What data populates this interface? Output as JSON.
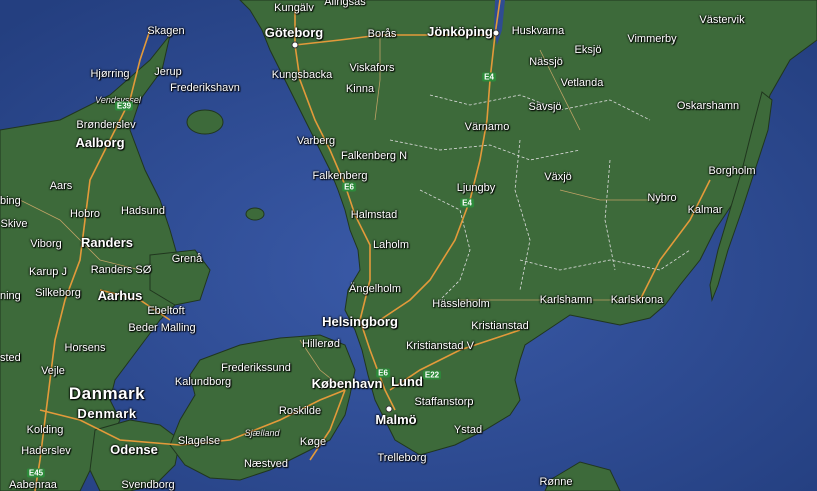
{
  "map": {
    "colors": {
      "sea": "#2f4c92",
      "land": "#3f6b3a",
      "land_dark": "#2f5530",
      "road": "#e8a040",
      "border": "#ffffff"
    },
    "labels": [
      {
        "name": "label-kungalv",
        "text": "Kungälv",
        "kind": "city"
      },
      {
        "name": "label-alingsas",
        "text": "Alingsås",
        "kind": "city"
      },
      {
        "name": "label-goteborg",
        "text": "Göteborg",
        "kind": "big"
      },
      {
        "name": "label-boras",
        "text": "Borås",
        "kind": "city"
      },
      {
        "name": "label-jonkoping",
        "text": "Jönköping",
        "kind": "big"
      },
      {
        "name": "label-huskvarna",
        "text": "Huskvarna",
        "kind": "city"
      },
      {
        "name": "label-vastervik",
        "text": "Västervik",
        "kind": "city"
      },
      {
        "name": "label-skagen",
        "text": "Skagen",
        "kind": "city"
      },
      {
        "name": "label-eksjo",
        "text": "Eksjö",
        "kind": "city"
      },
      {
        "name": "label-vimmerby",
        "text": "Vimmerby",
        "kind": "city"
      },
      {
        "name": "label-hjorring",
        "text": "Hjørring",
        "kind": "city"
      },
      {
        "name": "label-jerup",
        "text": "Jerup",
        "kind": "city"
      },
      {
        "name": "label-kungsbacka",
        "text": "Kungsbacka",
        "kind": "city"
      },
      {
        "name": "label-viskafors",
        "text": "Viskafors",
        "kind": "city"
      },
      {
        "name": "label-nassjo",
        "text": "Nässjö",
        "kind": "city"
      },
      {
        "name": "label-frederikshavn",
        "text": "Frederikshavn",
        "kind": "city"
      },
      {
        "name": "label-vendsyssel",
        "text": "Vendsyssel",
        "kind": "region"
      },
      {
        "name": "label-kinna",
        "text": "Kinna",
        "kind": "city"
      },
      {
        "name": "label-vetlanda",
        "text": "Vetlanda",
        "kind": "city"
      },
      {
        "name": "label-savsjo",
        "text": "Sävsjö",
        "kind": "city"
      },
      {
        "name": "label-oskarshamn",
        "text": "Oskarshamn",
        "kind": "city"
      },
      {
        "name": "label-bronderslev",
        "text": "Brønderslev",
        "kind": "city"
      },
      {
        "name": "label-varnamo",
        "text": "Värnamo",
        "kind": "city"
      },
      {
        "name": "label-aalborg",
        "text": "Aalborg",
        "kind": "big"
      },
      {
        "name": "label-varberg",
        "text": "Varberg",
        "kind": "city"
      },
      {
        "name": "label-falkenberg-n",
        "text": "Falkenberg N",
        "kind": "city"
      },
      {
        "name": "label-borgholm",
        "text": "Borgholm",
        "kind": "city"
      },
      {
        "name": "label-falkenberg",
        "text": "Falkenberg",
        "kind": "city"
      },
      {
        "name": "label-vaxjo",
        "text": "Växjö",
        "kind": "city"
      },
      {
        "name": "label-ljungby",
        "text": "Ljungby",
        "kind": "city"
      },
      {
        "name": "label-aars",
        "text": "Aars",
        "kind": "city"
      },
      {
        "name": "label-nybro",
        "text": "Nybro",
        "kind": "city"
      },
      {
        "name": "label-kalmar",
        "text": "Kalmar",
        "kind": "city"
      },
      {
        "name": "label-hobro",
        "text": "Hobro",
        "kind": "city"
      },
      {
        "name": "label-hadsund",
        "text": "Hadsund",
        "kind": "city"
      },
      {
        "name": "label-halmstad",
        "text": "Halmstad",
        "kind": "city"
      },
      {
        "name": "label-skive",
        "text": "Skive",
        "kind": "city"
      },
      {
        "name": "label-viborg",
        "text": "Viborg",
        "kind": "city"
      },
      {
        "name": "label-randers",
        "text": "Randers",
        "kind": "big"
      },
      {
        "name": "label-laholm",
        "text": "Laholm",
        "kind": "city"
      },
      {
        "name": "label-grena",
        "text": "Grenå",
        "kind": "city"
      },
      {
        "name": "label-karup-j",
        "text": "Karup J",
        "kind": "city"
      },
      {
        "name": "label-randers-so",
        "text": "Randers SØ",
        "kind": "city"
      },
      {
        "name": "label-angelholm",
        "text": "Ängelholm",
        "kind": "city"
      },
      {
        "name": "label-silkeborg",
        "text": "Silkeborg",
        "kind": "city"
      },
      {
        "name": "label-aarhus",
        "text": "Aarhus",
        "kind": "big"
      },
      {
        "name": "label-karlshamn",
        "text": "Karlshamn",
        "kind": "city"
      },
      {
        "name": "label-karlskrona",
        "text": "Karlskrona",
        "kind": "city"
      },
      {
        "name": "label-hassleholm",
        "text": "Hässleholm",
        "kind": "city"
      },
      {
        "name": "label-ebeltoft",
        "text": "Ebeltoft",
        "kind": "city"
      },
      {
        "name": "label-helsingborg",
        "text": "Helsingborg",
        "kind": "big"
      },
      {
        "name": "label-kristianstad",
        "text": "Kristianstad",
        "kind": "city"
      },
      {
        "name": "label-beder-malling",
        "text": "Beder Malling",
        "kind": "city"
      },
      {
        "name": "label-hillerod",
        "text": "Hillerød",
        "kind": "city"
      },
      {
        "name": "label-horsens",
        "text": "Horsens",
        "kind": "city"
      },
      {
        "name": "label-kristianstad-v",
        "text": "Kristianstad V",
        "kind": "city"
      },
      {
        "name": "label-frederikssund",
        "text": "Frederikssund",
        "kind": "city"
      },
      {
        "name": "label-vejle",
        "text": "Vejle",
        "kind": "city"
      },
      {
        "name": "label-kobenhavn",
        "text": "København",
        "kind": "big"
      },
      {
        "name": "label-lund",
        "text": "Lund",
        "kind": "big"
      },
      {
        "name": "label-kalundborg",
        "text": "Kalundborg",
        "kind": "city"
      },
      {
        "name": "label-danmark",
        "text": "Danmark",
        "kind": "country"
      },
      {
        "name": "label-staffanstorp",
        "text": "Staffanstorp",
        "kind": "city"
      },
      {
        "name": "label-roskilde",
        "text": "Roskilde",
        "kind": "city"
      },
      {
        "name": "label-denmark",
        "text": "Denmark",
        "kind": "country2"
      },
      {
        "name": "label-malmo",
        "text": "Malmö",
        "kind": "big"
      },
      {
        "name": "label-kolding",
        "text": "Kolding",
        "kind": "city"
      },
      {
        "name": "label-ystad",
        "text": "Ystad",
        "kind": "city"
      },
      {
        "name": "label-slagelse",
        "text": "Slagelse",
        "kind": "city"
      },
      {
        "name": "label-sjaelland",
        "text": "Sjælland",
        "kind": "region"
      },
      {
        "name": "label-koge",
        "text": "Køge",
        "kind": "city"
      },
      {
        "name": "label-haderslev",
        "text": "Haderslev",
        "kind": "city"
      },
      {
        "name": "label-odense",
        "text": "Odense",
        "kind": "big"
      },
      {
        "name": "label-trelleborg",
        "text": "Trelleborg",
        "kind": "city"
      },
      {
        "name": "label-naestved",
        "text": "Næstved",
        "kind": "city"
      },
      {
        "name": "label-ronne",
        "text": "Rønne",
        "kind": "city"
      },
      {
        "name": "label-aabenraa",
        "text": "Aabenraa",
        "kind": "city"
      },
      {
        "name": "label-svendborg",
        "text": "Svendborg",
        "kind": "city"
      },
      {
        "name": "label-ning",
        "text": "ning",
        "kind": "city"
      },
      {
        "name": "label-sted",
        "text": "sted",
        "kind": "city"
      },
      {
        "name": "label-bing",
        "text": "bing",
        "kind": "city"
      }
    ],
    "shields": [
      {
        "name": "shield-e4-north",
        "text": "E4"
      },
      {
        "name": "shield-e4-south",
        "text": "E4"
      },
      {
        "name": "shield-e6-north",
        "text": "E6"
      },
      {
        "name": "shield-e6-south",
        "text": "E6"
      },
      {
        "name": "shield-e22",
        "text": "E22"
      },
      {
        "name": "shield-e45",
        "text": "E45"
      },
      {
        "name": "shield-e39",
        "text": "E39"
      }
    ]
  }
}
